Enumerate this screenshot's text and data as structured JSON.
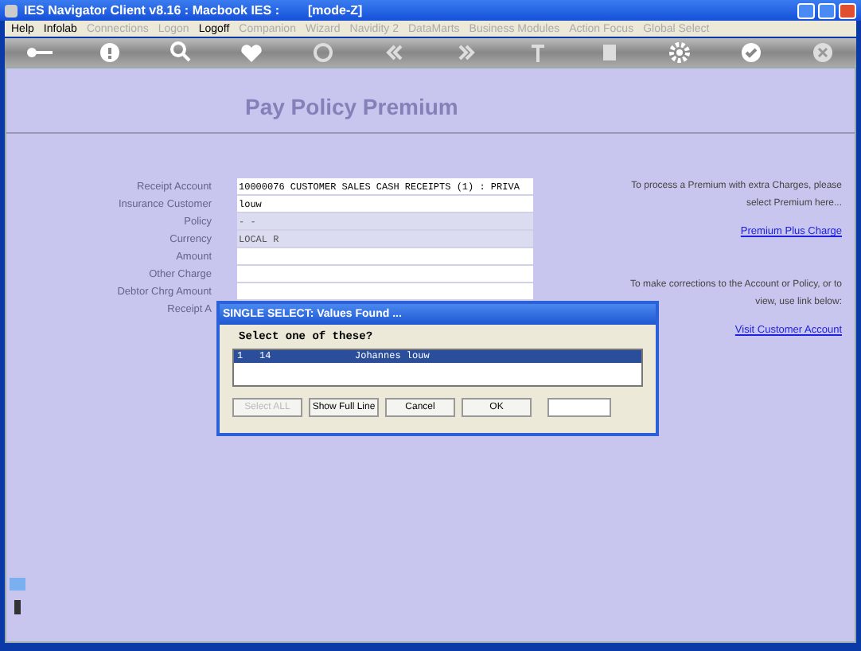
{
  "window": {
    "title": "IES Navigator Client v8.16 : Macbook IES :",
    "mode": "[mode-Z]"
  },
  "menu": [
    {
      "label": "Help",
      "disabled": false
    },
    {
      "label": "Infolab",
      "disabled": false
    },
    {
      "label": "Connections",
      "disabled": true
    },
    {
      "label": "Logon",
      "disabled": true
    },
    {
      "label": "Logoff",
      "disabled": false
    },
    {
      "label": "Companion",
      "disabled": true
    },
    {
      "label": "Wizard",
      "disabled": true
    },
    {
      "label": "Navidity 2",
      "disabled": true
    },
    {
      "label": "DataMarts",
      "disabled": true
    },
    {
      "label": "Business Modules",
      "disabled": true
    },
    {
      "label": "Action Focus",
      "disabled": true
    },
    {
      "label": "Global Select",
      "disabled": true
    }
  ],
  "page": {
    "title": "Pay Policy Premium"
  },
  "form": [
    {
      "label": "Receipt Account",
      "value": "10000076 CUSTOMER SALES CASH RECEIPTS (1) : PRIVA",
      "readonly": false
    },
    {
      "label": "Insurance Customer",
      "value": "louw",
      "readonly": false
    },
    {
      "label": "Policy",
      "value": "-  -",
      "readonly": true
    },
    {
      "label": "Currency",
      "value": "LOCAL R",
      "readonly": true
    },
    {
      "label": "Amount",
      "readonly": false
    },
    {
      "label": "Other Charge",
      "readonly": false
    },
    {
      "label": "Debtor Chrg Amount",
      "readonly": false
    },
    {
      "label": "Receipt A"
    }
  ],
  "side": [
    {
      "text": "To process a Premium with extra Charges, please select Premium here...",
      "link": "Premium Plus Charge"
    },
    {
      "text": "To make corrections to the Account or Policy, or to view, use link below:",
      "link": "Visit Customer Account"
    }
  ],
  "dialog": {
    "title": "SINGLE SELECT: Values Found ...",
    "prompt": "Select one of these?",
    "rows": [
      {
        "cells": [
          "1",
          "14",
          "Johannes louw"
        ],
        "selected": true
      }
    ],
    "buttons": [
      {
        "label": "Select ALL",
        "disabled": true
      },
      {
        "label": "Show Full Line",
        "disabled": false
      },
      {
        "label": "Cancel",
        "disabled": false
      },
      {
        "label": "OK",
        "disabled": false
      }
    ]
  }
}
